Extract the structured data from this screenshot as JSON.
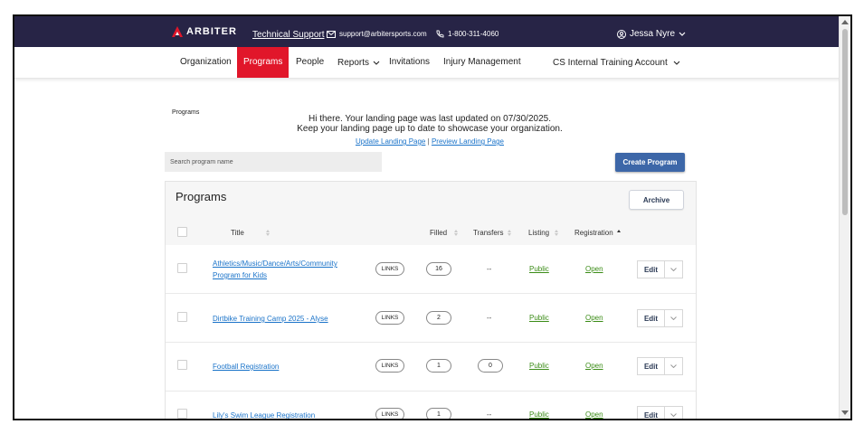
{
  "header": {
    "brand": "ARBITER",
    "support_link": "Technical Support",
    "email": "support@arbitersports.com",
    "phone": "1-800-311-4060",
    "user_name": "Jessa Nyre",
    "icons": [
      "arbiter-logo-icon",
      "mail-icon",
      "phone-icon",
      "user-circle-icon",
      "chevron-down-icon"
    ]
  },
  "nav": {
    "items": [
      {
        "label": "Organization",
        "active": false
      },
      {
        "label": "Programs",
        "active": true
      },
      {
        "label": "People",
        "active": false
      },
      {
        "label": "Reports",
        "active": false
      },
      {
        "label": "Invitations",
        "active": false
      },
      {
        "label": "Injury Management",
        "active": false
      }
    ],
    "account": "CS Internal Training Account"
  },
  "page": {
    "breadcrumb": "Programs",
    "landing_line1": "Hi there. Your landing page was last updated on 07/30/2025.",
    "landing_line2": "Keep your landing page up to date to showcase your organization.",
    "update_link": "Update Landing Page",
    "separator": "|",
    "preview_link": "Preview Landing Page",
    "search_placeholder": "Search program name",
    "create_button": "Create Program"
  },
  "panel": {
    "title": "Programs",
    "archive_button": "Archive",
    "columns": {
      "title": "Title",
      "filled": "Filled",
      "transfers": "Transfers",
      "listing": "Listing",
      "registration": "Registration"
    },
    "rows": [
      {
        "title": "Athletics/Music/Dance/Arts/Community Program for Kids",
        "links": "LINKS",
        "filled": "16",
        "transfers": "--",
        "listing": "Public",
        "registration": "Open",
        "edit": "Edit"
      },
      {
        "title": "Dirtbike Training Camp 2025 - Alyse",
        "links": "LINKS",
        "filled": "2",
        "transfers": "--",
        "listing": "Public",
        "registration": "Open",
        "edit": "Edit"
      },
      {
        "title": "Football Registration",
        "links": "LINKS",
        "filled": "1",
        "transfers": "0",
        "listing": "Public",
        "registration": "Open",
        "edit": "Edit"
      },
      {
        "title": "Lily's Swim League Registration",
        "links": "LINKS",
        "filled": "1",
        "transfers": "--",
        "listing": "Public",
        "registration": "Open",
        "edit": "Edit"
      }
    ]
  },
  "colors": {
    "topbar": "#272446",
    "active_nav": "#e1162a",
    "primary_button": "#3d67a8",
    "link": "#1a73c9",
    "status_green": "#3b8c17"
  }
}
